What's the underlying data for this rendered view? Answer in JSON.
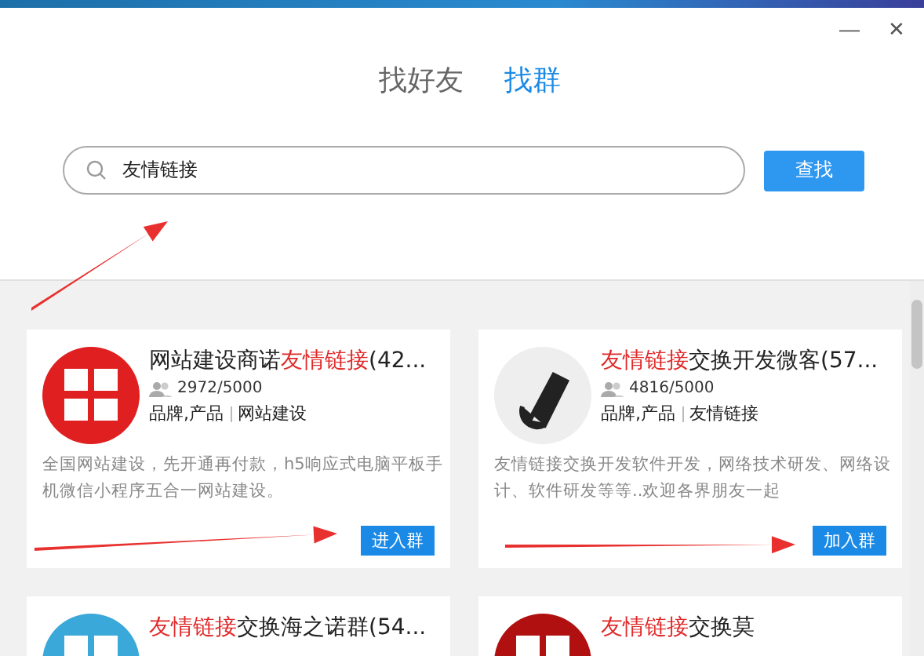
{
  "window_controls": [
    "—",
    "✕"
  ],
  "tabs": [
    {
      "label": "找好友",
      "selected": false
    },
    {
      "label": "找群",
      "selected": true
    }
  ],
  "search": {
    "value": "友情链接",
    "button": "查找"
  },
  "groups": [
    {
      "title": [
        {
          "text": "网站建设商诺",
          "highlight": false
        },
        {
          "text": "友情链接",
          "highlight": true
        },
        {
          "text": "(42...",
          "highlight": false
        }
      ],
      "members": "2972/5000",
      "tags": [
        "品牌,产品",
        "网站建设"
      ],
      "description": "全国网站建设，先开通再付款，h5响应式电脑平板手机微信小程序五合一网站建设。",
      "button": "进入群"
    },
    {
      "title": [
        {
          "text": "友情链接",
          "highlight": true
        },
        {
          "text": "交换开发微客(57...",
          "highlight": false
        }
      ],
      "members": "4816/5000",
      "tags": [
        "品牌,产品",
        "友情链接"
      ],
      "description": " 友情链接交换开发软件开发，网络技术研发、网络设计、软件研发等等..欢迎各界朋友一起",
      "button": "加入群"
    },
    {
      "title": [
        {
          "text": "友情链接",
          "highlight": true
        },
        {
          "text": "交换海之诺群(54...",
          "highlight": false
        }
      ]
    },
    {
      "title": [
        {
          "text": "友情链接",
          "highlight": true
        },
        {
          "text": "交换莫",
          "highlight": false
        }
      ]
    }
  ]
}
